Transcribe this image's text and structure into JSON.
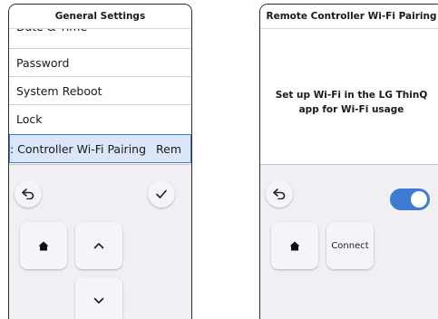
{
  "left_screen": {
    "title": "General Settings",
    "menu_items": [
      {
        "label": "Date & Time"
      },
      {
        "label": "Password"
      },
      {
        "label": "System Reboot"
      },
      {
        "label": "Lock"
      },
      {
        "label": ": Controller Wi-Fi Pairing",
        "extra": "Rem"
      }
    ]
  },
  "right_screen": {
    "title": "Remote Controller Wi-Fi Pairing",
    "message": "Set up Wi-Fi in the LG ThinQ app for Wi-Fi usage",
    "connect_label": "Connect",
    "toggle_on": true
  },
  "colors": {
    "accent": "#3e7bd3",
    "selected_bg": "#dbe7f8",
    "remote_bg": "#f1eef4"
  },
  "icons": [
    "back-arrow-icon",
    "check-icon",
    "home-icon",
    "chevron-up-icon",
    "chevron-down-icon"
  ]
}
